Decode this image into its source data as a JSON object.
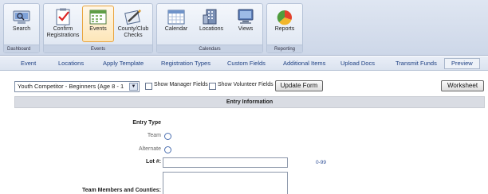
{
  "ribbon": {
    "groups": [
      {
        "label": "Dashboard",
        "buttons": [
          {
            "label": "Search",
            "icon": "search-icon"
          }
        ]
      },
      {
        "label": "Events",
        "buttons": [
          {
            "label": "Confirm Registrations",
            "icon": "clipboard-check-icon"
          },
          {
            "label": "Events",
            "icon": "calendar-grid-icon",
            "active": true
          },
          {
            "label": "County/Club Checks",
            "icon": "pencil-paper-icon"
          }
        ]
      },
      {
        "label": "Calendars",
        "buttons": [
          {
            "label": "Calendar",
            "icon": "calendar-icon"
          },
          {
            "label": "Locations",
            "icon": "building-icon"
          },
          {
            "label": "Views",
            "icon": "monitor-icon"
          }
        ]
      },
      {
        "label": "Reporting",
        "buttons": [
          {
            "label": "Reports",
            "icon": "pie-chart-icon"
          }
        ]
      }
    ]
  },
  "tabs": [
    "Event",
    "Locations",
    "Apply Template",
    "Registration Types",
    "Custom Fields",
    "Additional Items",
    "Upload Docs",
    "Transmit Funds",
    "Preview"
  ],
  "selected_tab": "Preview",
  "controls": {
    "registration_type": "Youth Competitor - Beginners (Age 8 - 1",
    "show_manager_fields": "Show Manager Fields",
    "show_volunteer_fields": "Show Volunteer Fields",
    "update_form": "Update Form",
    "worksheet": "Worksheet"
  },
  "section": {
    "title": "Entry Information"
  },
  "form": {
    "entry_type_label": "Entry Type",
    "team_label": "Team",
    "alternate_label": "Alternate",
    "lot_label": "Lot #:",
    "lot_range": "0-99",
    "team_members_label": "Team Members and Counties:"
  },
  "colors": {
    "accent": "#e8a33c",
    "link": "#1d3f82",
    "ribbon": "#cdd7e8"
  }
}
